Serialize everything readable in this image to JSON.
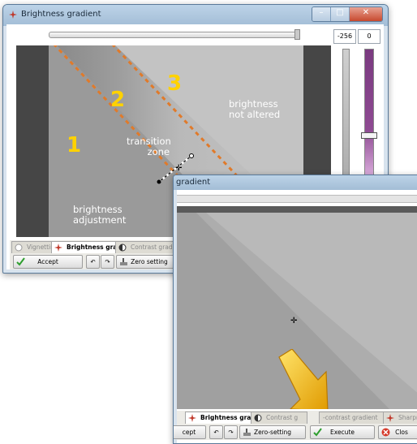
{
  "window1": {
    "title": "Brightness gradient",
    "slider_left_value": "-256",
    "slider_right_value": "0",
    "labels": {
      "brightness_not_altered": "brightness\nnot altered",
      "transition_zone": "transition\n       zone",
      "brightness_adjustment": "brightness\nadjustment"
    },
    "zones": [
      "1",
      "2",
      "3"
    ],
    "tabs": [
      "Vignetting",
      "Brightness gradient",
      "Contrast grad"
    ],
    "buttons": {
      "accept": "Accept",
      "zero_setting": "Zero setting"
    }
  },
  "window2": {
    "title": "gradient",
    "tabs": [
      "Brightness gradient",
      "Contrast g",
      "-contrast gradient",
      "Sharpne"
    ],
    "buttons": {
      "accept": "cept",
      "zero_setting": "Zero-setting",
      "execute": "Execute",
      "close": "Clos"
    }
  },
  "colors": {
    "dash": "#e07a2a",
    "zone_number": "#ffd200",
    "vertical_slider": "#8a3f8e",
    "vertical_slider_light": "#d7a9d9",
    "arrow": "#f2b200"
  },
  "icons": [
    "brightness-gradient-icon",
    "undo-icon",
    "redo-icon",
    "zero-setting-icon",
    "accept-check-icon",
    "execute-check-icon",
    "close-icon"
  ]
}
